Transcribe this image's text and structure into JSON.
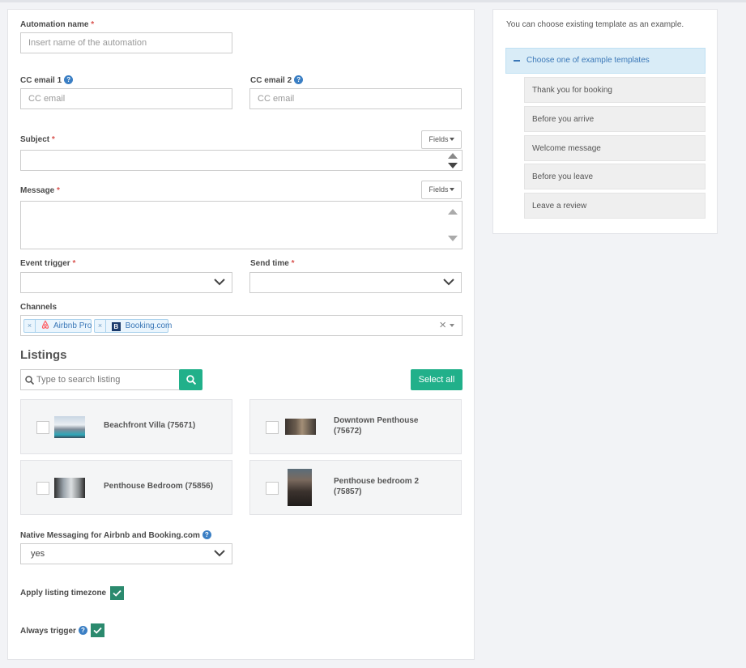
{
  "form": {
    "automation_name": {
      "label": "Automation name",
      "required": "*",
      "placeholder": "Insert name of the automation"
    },
    "cc_email_1": {
      "label": "CC email 1",
      "placeholder": "CC email"
    },
    "cc_email_2": {
      "label": "CC email 2",
      "placeholder": "CC email"
    },
    "subject": {
      "label": "Subject",
      "required": "*",
      "fields_button": "Fields"
    },
    "message": {
      "label": "Message",
      "required": "*",
      "fields_button": "Fields"
    },
    "event_trigger": {
      "label": "Event trigger",
      "required": "*",
      "value": ""
    },
    "send_time": {
      "label": "Send time",
      "required": "*",
      "value": ""
    },
    "channels": {
      "label": "Channels",
      "selected": [
        {
          "name": "Airbnb Pro",
          "icon": "airbnb-icon"
        },
        {
          "name": "Booking.com",
          "icon": "booking-icon"
        }
      ],
      "clear_symbol": "×"
    }
  },
  "listings": {
    "heading": "Listings",
    "search_placeholder": "Type to search listing",
    "select_all": "Select all",
    "items": [
      {
        "name": "Beachfront Villa (75671)",
        "checked": false
      },
      {
        "name": "Downtown Penthouse (75672)",
        "checked": false
      },
      {
        "name": "Penthouse Bedroom (75856)",
        "checked": false
      },
      {
        "name": "Penthouse bedroom 2 (75857)",
        "checked": false
      }
    ]
  },
  "native_messaging": {
    "label": "Native Messaging for Airbnb and Booking.com",
    "value": "yes"
  },
  "apply_timezone": {
    "label": "Apply listing timezone",
    "checked": true
  },
  "always_trigger": {
    "label": "Always trigger",
    "checked": true
  },
  "templates": {
    "hint": "You can choose existing template as an example.",
    "header": "Choose one of example templates",
    "items": [
      "Thank you for booking",
      "Before you arrive",
      "Welcome message",
      "Before you leave",
      "Leave a review"
    ]
  },
  "colors": {
    "accent_green": "#21b08a",
    "checkbox_green": "#2b8a6e",
    "help_blue": "#3b7fc4",
    "required_red": "#d9534f",
    "template_header_bg": "#d9ecf7"
  }
}
